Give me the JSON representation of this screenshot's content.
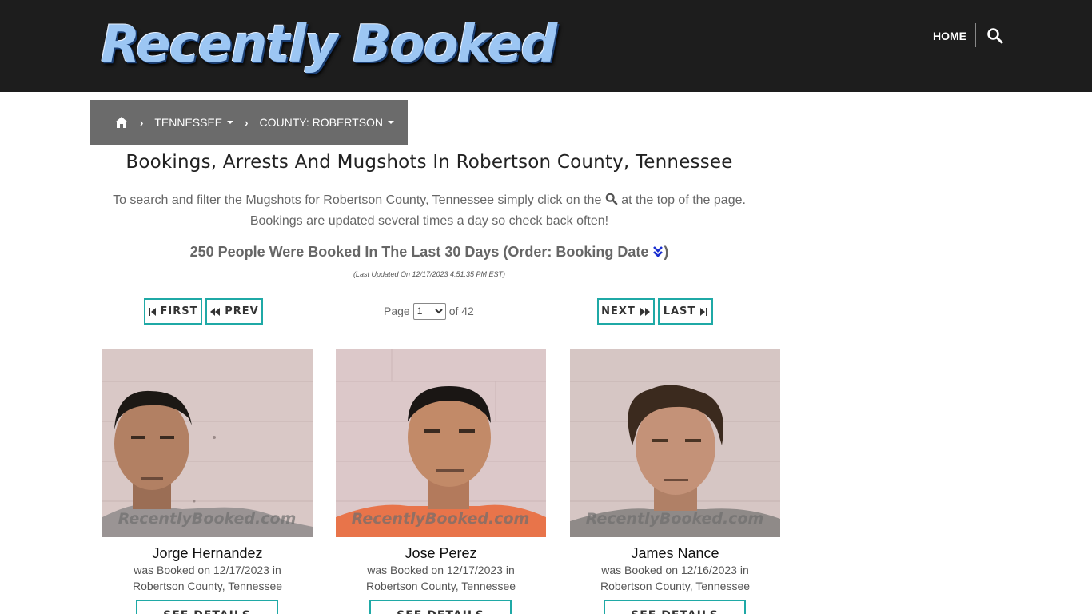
{
  "header": {
    "logo_text": "Recently Booked",
    "nav_home": "HOME",
    "search_icon": "search-icon"
  },
  "breadcrumb": {
    "home_icon": "home-icon",
    "state": "TENNESSEE",
    "county": "COUNTY: ROBERTSON"
  },
  "main": {
    "title": "Bookings, Arrests And Mugshots In Robertson County, Tennessee",
    "intro_before_icon": "To search and filter the Mugshots for Robertson County, Tennessee simply click on the",
    "intro_after_icon": "at the top of the page.",
    "intro_line2": "Bookings are updated several times a day so check back often!",
    "count_text": "250 People Were Booked In The Last 30 Days (Order: Booking Date",
    "count_close": ")",
    "last_updated": "(Last Updated On 12/17/2023 4:51:35 PM EST)"
  },
  "pagination": {
    "first": "FIRST",
    "prev": "PREV",
    "next": "NEXT",
    "last": "LAST",
    "page_label": "Page",
    "current_page": "1",
    "of_label": "of 42"
  },
  "bookings": [
    {
      "name": "Jorge Hernandez",
      "line1": "was Booked on 12/17/2023 in",
      "line2": "Robertson County, Tennessee",
      "button": "SEE DETAILS",
      "watermark": "RecentlyBooked.com"
    },
    {
      "name": "Jose Perez",
      "line1": "was Booked on 12/17/2023 in",
      "line2": "Robertson County, Tennessee",
      "button": "SEE DETAILS",
      "watermark": "RecentlyBooked.com"
    },
    {
      "name": "James Nance",
      "line1": "was Booked on 12/16/2023 in",
      "line2": "Robertson County, Tennessee",
      "button": "SEE DETAILS",
      "watermark": "RecentlyBooked.com"
    }
  ],
  "colors": {
    "header_bg": "#1d1d1d",
    "breadcrumb_bg": "#6b6b6b",
    "accent_teal": "#1fa9a6",
    "logo_blue": "#9cc6f3"
  }
}
